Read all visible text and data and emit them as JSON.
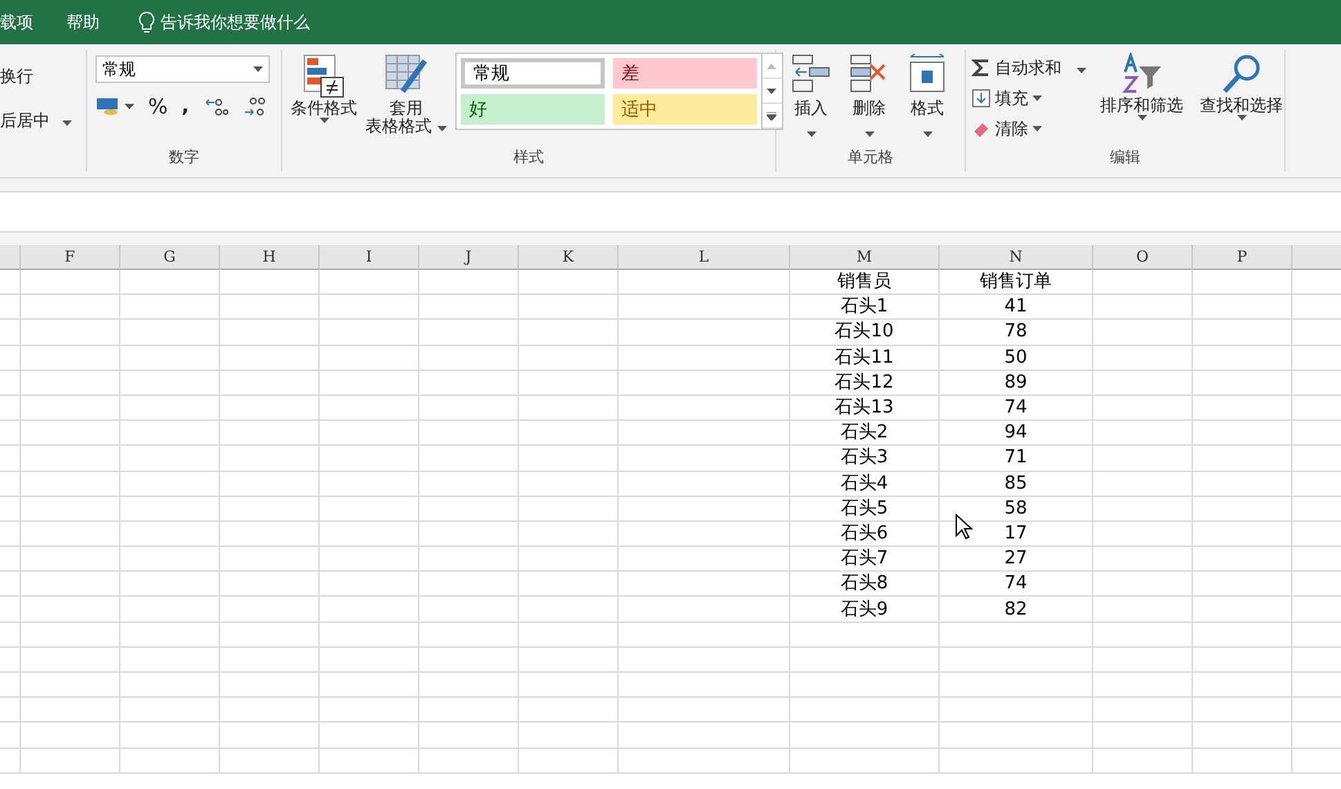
{
  "tabs": [
    {
      "label": "载项"
    },
    {
      "label": "帮助"
    }
  ],
  "tell_me": "告诉我你想要做什么",
  "alignment": {
    "wrap": "换行",
    "merge": "后居中"
  },
  "number": {
    "format": "常规",
    "percent": "%",
    "comma": ",",
    "title": "数字"
  },
  "styles": {
    "conditional": "条件格式",
    "table_line1": "套用",
    "table_line2": "表格格式",
    "title": "样式",
    "cells": [
      {
        "label": "常规",
        "kind": "normal"
      },
      {
        "label": "差",
        "kind": "bad"
      },
      {
        "label": "好",
        "kind": "good"
      },
      {
        "label": "适中",
        "kind": "neutral"
      }
    ]
  },
  "cells_group": {
    "title": "单元格",
    "buttons": [
      {
        "label": "插入",
        "kind": "insert"
      },
      {
        "label": "删除",
        "kind": "delete"
      },
      {
        "label": "格式",
        "kind": "format"
      }
    ]
  },
  "editing": {
    "title": "编辑",
    "autosum": "自动求和",
    "fill": "填充",
    "clear": "清除",
    "sort": "排序和筛选",
    "find": "查找和选择"
  },
  "columns": [
    "F",
    "G",
    "H",
    "I",
    "J",
    "K",
    "L",
    "M",
    "N",
    "O",
    "P"
  ],
  "table": {
    "headers": [
      "销售员",
      "销售订单"
    ],
    "rows": [
      [
        "石头1",
        "41"
      ],
      [
        "石头10",
        "78"
      ],
      [
        "石头11",
        "50"
      ],
      [
        "石头12",
        "89"
      ],
      [
        "石头13",
        "74"
      ],
      [
        "石头2",
        "94"
      ],
      [
        "石头3",
        "71"
      ],
      [
        "石头4",
        "85"
      ],
      [
        "石头5",
        "58"
      ],
      [
        "石头6",
        "17"
      ],
      [
        "石头7",
        "27"
      ],
      [
        "石头8",
        "74"
      ],
      [
        "石头9",
        "82"
      ]
    ]
  }
}
